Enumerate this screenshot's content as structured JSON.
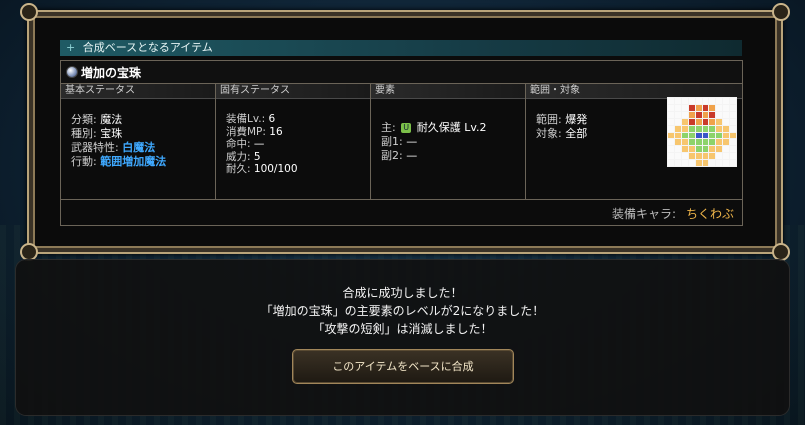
{
  "section_header": "合成ベースとなるアイテム",
  "item_name": "増加の宝珠",
  "columns": {
    "basic": "基本ステータス",
    "unique": "固有ステータス",
    "element": "要素",
    "range": "範囲・対象"
  },
  "basic_status": [
    {
      "key": "分類:",
      "value": "魔法"
    },
    {
      "key": "種別:",
      "value": "宝珠"
    },
    {
      "key": "武器特性:",
      "value": "白魔法"
    },
    {
      "key": "行動:",
      "value": "範囲増加魔法"
    }
  ],
  "unique_status": [
    {
      "key": "装備Lv.:",
      "value": "6"
    },
    {
      "key": "消費MP:",
      "value": "16"
    },
    {
      "key": "命中:",
      "value": "—"
    },
    {
      "key": "威力:",
      "value": "5"
    },
    {
      "key": "耐久:",
      "value": "100/100"
    }
  ],
  "elements": {
    "main_key": "主:",
    "main_icon_letter": "U",
    "main_value": "耐久保護 Lv.2",
    "sub1_key": "副1:",
    "sub1_value": "—",
    "sub2_key": "副2:",
    "sub2_value": "—"
  },
  "range_target": {
    "range_key": "範囲:",
    "range_value": "爆発",
    "target_key": "対象:",
    "target_value": "全部"
  },
  "equip": {
    "label": "装備キャラ:",
    "value": "ちくわぶ"
  },
  "messages": [
    "合成に成功しました！",
    "「増加の宝珠」の主要素のレベルが2になりました！",
    "「攻撃の短剣」は消滅しました！"
  ],
  "synth_button_label": "このアイテムをベースに合成",
  "colors": {
    "accent_blue": "#3fa9ff",
    "equip_name": "#f0b64a",
    "frame_gold": "#b9a47a"
  }
}
